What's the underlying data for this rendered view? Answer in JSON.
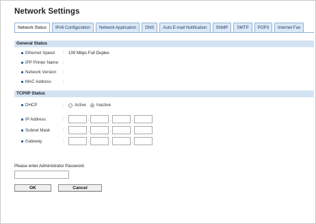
{
  "page": {
    "title": "Network Settings"
  },
  "tabs": [
    {
      "label": "Network Status",
      "active": true
    },
    {
      "label": "IPv6 Configuration"
    },
    {
      "label": "Network Application"
    },
    {
      "label": "DNS"
    },
    {
      "label": "Auto E-mail Notification"
    },
    {
      "label": "SNMP"
    },
    {
      "label": "SMTP"
    },
    {
      "label": "POP3"
    },
    {
      "label": "Internet Fax"
    }
  ],
  "general_status": {
    "heading": "General Status",
    "rows": [
      {
        "label": "Ethernet Speed",
        "separator": ":",
        "value": "100 Mbps Full Duplex"
      },
      {
        "label": "IPP Printer Name",
        "separator": ":",
        "value": ""
      },
      {
        "label": "Network Version",
        "separator": ":",
        "value": ""
      },
      {
        "label": "MAC Address",
        "separator": ":",
        "value": ""
      }
    ]
  },
  "tcpip_status": {
    "heading": "TCP/IP Status",
    "dhcp": {
      "label": "DHCP",
      "separator": ":",
      "options": [
        {
          "label": "Active",
          "selected": false
        },
        {
          "label": "Inactive",
          "selected": true
        }
      ]
    },
    "ip_address": {
      "label": "IP Address",
      "separator": ":",
      "octets": [
        "",
        "",
        "",
        ""
      ]
    },
    "subnet_mask": {
      "label": "Subnet Mask",
      "separator": ":",
      "octets": [
        "",
        "",
        "",
        ""
      ]
    },
    "gateway": {
      "label": "Gateway",
      "separator": ":",
      "octets": [
        "",
        "",
        "",
        ""
      ]
    },
    "octet_separator": "."
  },
  "password": {
    "label": "Please enter Administrator Password.",
    "value": ""
  },
  "buttons": {
    "ok": "OK",
    "cancel": "Cancel"
  },
  "colors": {
    "accent": "#8fb1d8",
    "section_bg": "#d4e3f3",
    "tab_bg": "#dbe8f6"
  }
}
